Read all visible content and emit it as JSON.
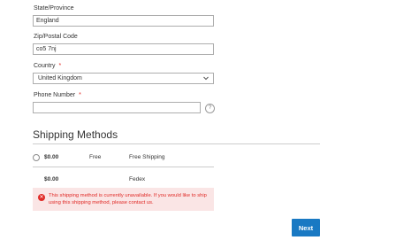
{
  "form": {
    "state": {
      "label": "State/Province",
      "value": "England"
    },
    "zip": {
      "label": "Zip/Postal Code",
      "value": "co5 7nj"
    },
    "country": {
      "label": "Country",
      "required_mark": "*",
      "value": "United Kingdom"
    },
    "phone": {
      "label": "Phone Number",
      "required_mark": "*",
      "value": "",
      "help": "?"
    }
  },
  "shipping": {
    "title": "Shipping Methods",
    "methods": [
      {
        "price": "$0.00",
        "method": "Free",
        "carrier": "Free Shipping"
      },
      {
        "price": "$0.00",
        "method": "",
        "carrier": "Fedex"
      }
    ],
    "error": {
      "icon": "error-icon",
      "text": "This shipping method is currently unavailable. If you would like to ship using this shipping method, please contact us."
    }
  },
  "actions": {
    "next_label": "Next"
  },
  "colors": {
    "primary": "#1979c3",
    "error": "#e02b27",
    "error_bg": "#fae5e5",
    "border": "#adadad"
  }
}
